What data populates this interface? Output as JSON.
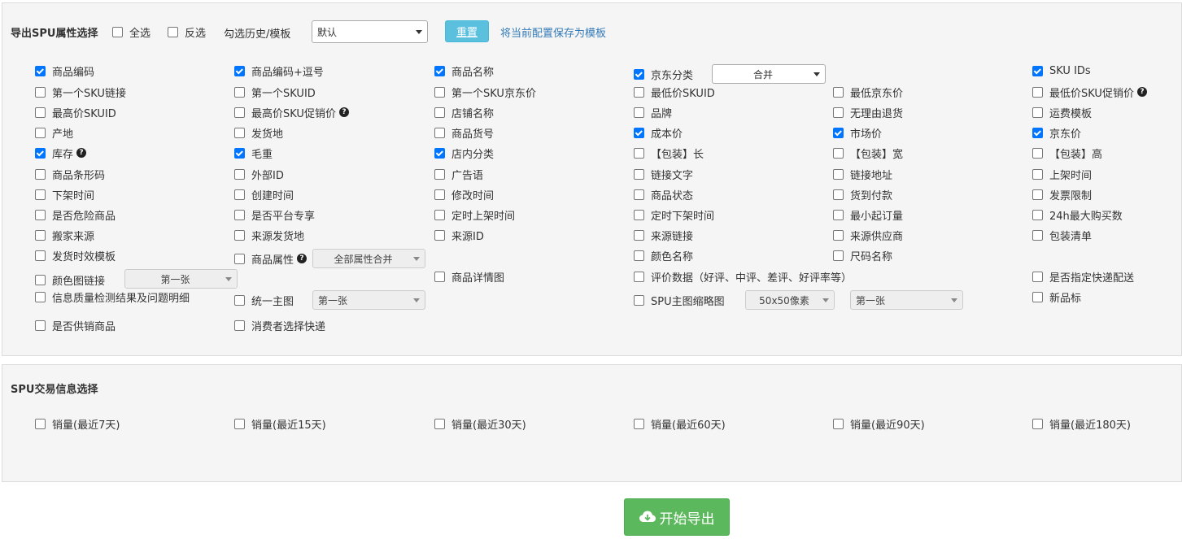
{
  "section1": {
    "title": "导出SPU属性选择",
    "select_all": "全选",
    "invert": "反选",
    "history_label": "勾选历史/模板",
    "history_select": "默认",
    "reset_button": "重置",
    "save_template_link": "将当前配置保存为模板"
  },
  "attributes": [
    {
      "label": "商品编码",
      "checked": true
    },
    {
      "label": "商品编码+逗号",
      "checked": true
    },
    {
      "label": "商品名称",
      "checked": true
    },
    {
      "label": "京东分类",
      "checked": true,
      "select": "合并"
    },
    {
      "label": "SKU IDs",
      "checked": true
    },
    {
      "label": "第一个SKU链接",
      "checked": false
    },
    {
      "label": "第一个SKUID",
      "checked": false
    },
    {
      "label": "第一个SKU京东价",
      "checked": false
    },
    {
      "label": "最低价SKUID",
      "checked": false
    },
    {
      "label": "最低京东价",
      "checked": false
    },
    {
      "label": "最低价SKU促销价",
      "checked": false,
      "help": true
    },
    {
      "label": "最高价SKUID",
      "checked": false
    },
    {
      "label": "最高价SKU促销价",
      "checked": false,
      "help": true
    },
    {
      "label": "店铺名称",
      "checked": false
    },
    {
      "label": "品牌",
      "checked": false
    },
    {
      "label": "无理由退货",
      "checked": false
    },
    {
      "label": "运费模板",
      "checked": false
    },
    {
      "label": "产地",
      "checked": false
    },
    {
      "label": "发货地",
      "checked": false
    },
    {
      "label": "商品货号",
      "checked": false
    },
    {
      "label": "成本价",
      "checked": true
    },
    {
      "label": "市场价",
      "checked": true
    },
    {
      "label": "京东价",
      "checked": true
    },
    {
      "label": "库存",
      "checked": true,
      "help": true
    },
    {
      "label": "毛重",
      "checked": true
    },
    {
      "label": "店内分类",
      "checked": true
    },
    {
      "label": "【包装】长",
      "checked": false
    },
    {
      "label": "【包装】宽",
      "checked": false
    },
    {
      "label": "【包装】高",
      "checked": false
    },
    {
      "label": "商品条形码",
      "checked": false
    },
    {
      "label": "外部ID",
      "checked": false
    },
    {
      "label": "广告语",
      "checked": false
    },
    {
      "label": "链接文字",
      "checked": false
    },
    {
      "label": "链接地址",
      "checked": false
    },
    {
      "label": "上架时间",
      "checked": false
    },
    {
      "label": "下架时间",
      "checked": false
    },
    {
      "label": "创建时间",
      "checked": false
    },
    {
      "label": "修改时间",
      "checked": false
    },
    {
      "label": "商品状态",
      "checked": false
    },
    {
      "label": "货到付款",
      "checked": false
    },
    {
      "label": "发票限制",
      "checked": false
    },
    {
      "label": "是否危险商品",
      "checked": false
    },
    {
      "label": "是否平台专享",
      "checked": false
    },
    {
      "label": "定时上架时间",
      "checked": false
    },
    {
      "label": "定时下架时间",
      "checked": false
    },
    {
      "label": "最小起订量",
      "checked": false
    },
    {
      "label": "24h最大购买数",
      "checked": false
    },
    {
      "label": "搬家来源",
      "checked": false
    },
    {
      "label": "来源发货地",
      "checked": false
    },
    {
      "label": "来源ID",
      "checked": false
    },
    {
      "label": "来源链接",
      "checked": false
    },
    {
      "label": "来源供应商",
      "checked": false
    },
    {
      "label": "包装清单",
      "checked": false
    },
    {
      "label": "发货时效模板",
      "checked": false
    },
    {
      "label": "商品属性",
      "checked": false,
      "help": true,
      "select": "全部属性合并"
    },
    {
      "label": "颜色名称",
      "checked": false
    },
    {
      "label": "尺码名称",
      "checked": false
    },
    {
      "label": "颜色图链接",
      "checked": false,
      "select": "第一张"
    },
    {
      "label": "商品详情图",
      "checked": false
    },
    {
      "label": "评价数据（好评、中评、差评、好评率等）",
      "checked": false
    },
    {
      "label": "是否指定快递配送",
      "checked": false
    },
    {
      "label": "信息质量检测结果及问题明细",
      "checked": false
    },
    {
      "label": "统一主图",
      "checked": false,
      "select": "第一张"
    },
    {
      "label": "SPU主图缩略图",
      "checked": false,
      "select": "50x50像素",
      "select2": "第一张"
    },
    {
      "label": "新品标",
      "checked": false
    },
    {
      "label": "是否供销商品",
      "checked": false
    },
    {
      "label": "消费者选择快递",
      "checked": false
    }
  ],
  "section2": {
    "title": "SPU交易信息选择",
    "items": [
      {
        "label": "销量(最近7天)",
        "checked": false
      },
      {
        "label": "销量(最近15天)",
        "checked": false
      },
      {
        "label": "销量(最近30天)",
        "checked": false
      },
      {
        "label": "销量(最近60天)",
        "checked": false
      },
      {
        "label": "销量(最近90天)",
        "checked": false
      },
      {
        "label": "销量(最近180天)",
        "checked": false
      }
    ]
  },
  "export_button": "开始导出",
  "icons": {
    "export": "cloud-download-icon",
    "help": "question-circle-icon"
  },
  "colors": {
    "checkbox_checked": "#0075ff",
    "reset_button": "#5bc0de",
    "export_button": "#5cb85c",
    "link": "#337ab7"
  }
}
